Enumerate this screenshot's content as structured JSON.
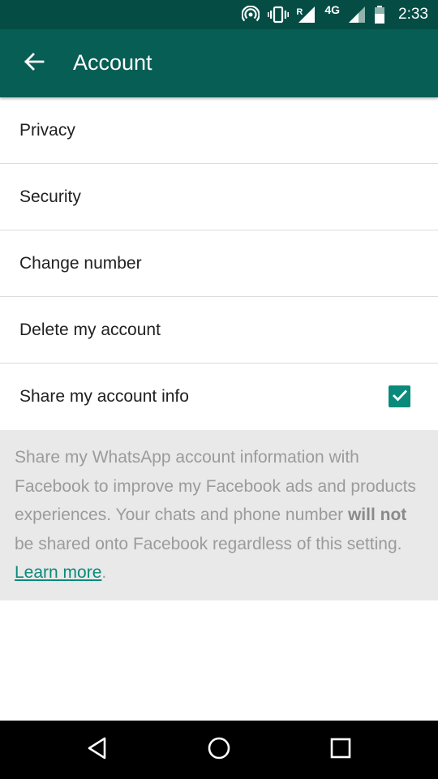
{
  "status_bar": {
    "time": "2:33",
    "network": "4G",
    "roaming": "R",
    "icons": [
      "hotspot-icon",
      "vibrate-icon",
      "signal-roaming-icon",
      "signal-icon",
      "battery-icon"
    ]
  },
  "app_bar": {
    "title": "Account",
    "back_icon": "arrow-back-icon",
    "color": "#075e54"
  },
  "menu": {
    "items": [
      {
        "label": "Privacy"
      },
      {
        "label": "Security"
      },
      {
        "label": "Change number"
      },
      {
        "label": "Delete my account"
      },
      {
        "label": "Share my account info",
        "checked": true
      }
    ]
  },
  "info": {
    "text_before": "Share my WhatsApp account information with Facebook to improve my Facebook ads and products experiences. Your chats and phone number ",
    "bold": "will not",
    "text_after": " be shared onto Facebook regardless of this setting. ",
    "link": "Learn more",
    "end": "."
  },
  "nav_bar": {
    "buttons": [
      "back-triangle-icon",
      "home-circle-icon",
      "recents-square-icon"
    ]
  },
  "colors": {
    "accent": "#0a8a7a",
    "status_bar": "#054d44",
    "info_bg": "#e9e9e9"
  }
}
